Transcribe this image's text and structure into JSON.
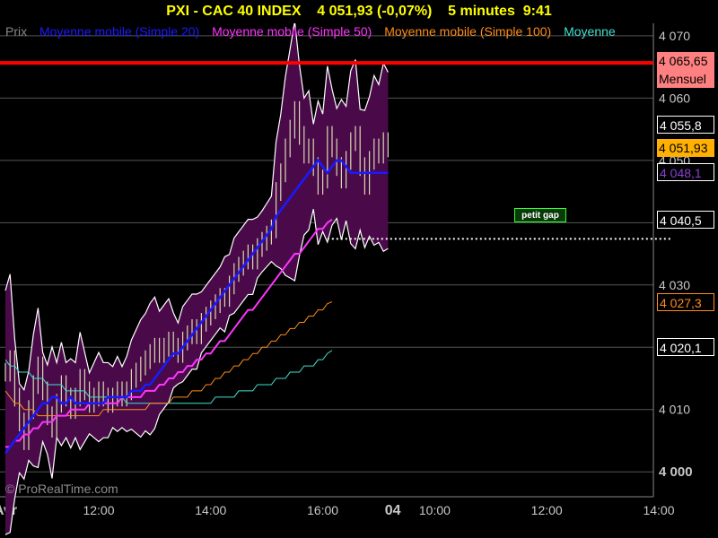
{
  "title": "PXI - CAC 40 INDEX    4 051,93 (-0,07%)    5 minutes  9:41",
  "legend": [
    {
      "label": "Prix",
      "color": "#888888"
    },
    {
      "label": "Moyenne mobile (Simple 20)",
      "color": "#1a1aff"
    },
    {
      "label": "Moyenne mobile (Simple 50)",
      "color": "#ff33ff"
    },
    {
      "label": "Moyenne mobile (Simple 100)",
      "color": "#ff8c1a"
    },
    {
      "label": "Moyenne",
      "color": "#40e0d0"
    }
  ],
  "watermark": "© ProRealTime.com",
  "annotation": "petit gap",
  "price_tags": [
    {
      "value": "4 065,65",
      "sub": "Mensuel",
      "bg": "#ff8080",
      "fg": "#000000",
      "y": 4065.65
    },
    {
      "value": "4 055,8",
      "bg": "#000000",
      "fg": "#ffffff",
      "border": "#ffffff",
      "y": 4055.8
    },
    {
      "value": "4 051,93",
      "bg": "#ffb000",
      "fg": "#000000",
      "y": 4051.93
    },
    {
      "value": "4 048,1",
      "bg": "#000000",
      "fg": "#8b3fd9",
      "border": "#ffffff",
      "y": 4048.1
    },
    {
      "value": "4 040,5",
      "bg": "#000000",
      "fg": "#ffffff",
      "border": "#ffffff",
      "y": 4040.5
    },
    {
      "value": "4 027,3",
      "bg": "#000000",
      "fg": "#ff8c1a",
      "border": "#ff8c1a",
      "y": 4027.3
    },
    {
      "value": "4 020,1",
      "bg": "#000000",
      "fg": "#ffffff",
      "border": "#ffffff",
      "y": 4020.1
    }
  ],
  "chart_data": {
    "type": "line",
    "ylim": [
      3996,
      4072
    ],
    "yticks": [
      {
        "value": 4000,
        "label": "4 000"
      },
      {
        "value": 4010,
        "label": "4 010"
      },
      {
        "value": 4020,
        "label": "4 020"
      },
      {
        "value": 4030,
        "label": "4 030"
      },
      {
        "value": 4040,
        "label": "4 040"
      },
      {
        "value": 4050,
        "label": "4 050"
      },
      {
        "value": 4060,
        "label": "4 060"
      },
      {
        "value": 4070,
        "label": "4 070"
      }
    ],
    "xticks": [
      {
        "index": 0,
        "label": "Avr"
      },
      {
        "index": 20,
        "label": "12:00"
      },
      {
        "index": 44,
        "label": "14:00"
      },
      {
        "index": 68,
        "label": "16:00"
      },
      {
        "index": 83,
        "label": "04"
      },
      {
        "index": 92,
        "label": "10:00"
      },
      {
        "index": 116,
        "label": "12:00"
      },
      {
        "index": 140,
        "label": "14:00"
      }
    ],
    "x_count": 145,
    "resistance_line": 4065.65,
    "gap_line": {
      "y": 4037.4,
      "from_index": 69,
      "to_index": 143
    },
    "price": [
      4016,
      4018,
      4012,
      4008,
      4005,
      4010,
      4014,
      4017,
      4013,
      4009,
      4007,
      4011,
      4014,
      4012,
      4010,
      4012,
      4015,
      4013,
      4011,
      4012,
      4013,
      4012,
      4011,
      4012,
      4013,
      4012,
      4013,
      4015,
      4016,
      4017,
      4018,
      4019,
      4020,
      4019,
      4020,
      4021,
      4020,
      4019,
      4021,
      4022,
      4023,
      4022,
      4024,
      4025,
      4026,
      4027,
      4028,
      4028,
      4030,
      4032,
      4033,
      4034,
      4035,
      4034,
      4036,
      4037,
      4038,
      4039,
      4045,
      4048,
      4052,
      4055,
      4058,
      4054,
      4051,
      4052,
      4049,
      4046,
      4047,
      4054,
      4052,
      4049,
      4047,
      4050,
      4053,
      4054,
      4049,
      4046,
      4050,
      4052,
      4051,
      4053,
      4052
    ],
    "sma20": [
      4003,
      4004,
      4005,
      4006,
      4007,
      4008,
      4009,
      4010,
      4011,
      4011,
      4012,
      4012,
      4011,
      4011,
      4012,
      4011,
      4011,
      4011,
      4011,
      4011,
      4011,
      4011,
      4012,
      4012,
      4012,
      4012,
      4012,
      4013,
      4013,
      4013,
      4014,
      4014,
      4015,
      4016,
      4017,
      4018,
      4019,
      4019,
      4020,
      4021,
      4022,
      4023,
      4024,
      4025,
      4026,
      4027,
      4028,
      4029,
      4030,
      4031,
      4032,
      4033,
      4034,
      4035,
      4036,
      4037,
      4038,
      4039,
      4041,
      4042,
      4043,
      4044,
      4045,
      4046,
      4047,
      4048,
      4049,
      4050,
      4049,
      4048,
      4049,
      4050,
      4050,
      4049,
      4048,
      4048,
      4048,
      4048,
      4048,
      4048,
      4048,
      4048,
      4048
    ],
    "sma50": [
      4004,
      4004,
      4005,
      4005,
      4006,
      4006,
      4007,
      4007,
      4008,
      4008,
      4008,
      4009,
      4009,
      4009,
      4010,
      4010,
      4010,
      4010,
      4011,
      4011,
      4011,
      4011,
      4011,
      4011,
      4011,
      4012,
      4012,
      4012,
      4012,
      4012,
      4013,
      4013,
      4013,
      4014,
      4014,
      4015,
      4015,
      4016,
      4016,
      4017,
      4017,
      4018,
      4018,
      4019,
      4019,
      4020,
      4021,
      4021,
      4022,
      4023,
      4024,
      4025,
      4026,
      4026,
      4027,
      4028,
      4029,
      4030,
      4031,
      4032,
      4033,
      4034,
      4035,
      4035,
      4036,
      4037,
      4038,
      4039,
      4039,
      4040,
      4040.5
    ],
    "sma100": [
      4013,
      4012,
      4011,
      4011,
      4010,
      4010,
      4010,
      4009,
      4009,
      4009,
      4009,
      4009,
      4009,
      4009,
      4009,
      4009,
      4009,
      4009,
      4009,
      4009,
      4009,
      4010,
      4010,
      4010,
      4010,
      4010,
      4010,
      4010,
      4010,
      4010,
      4010,
      4011,
      4011,
      4011,
      4011,
      4011,
      4012,
      4012,
      4012,
      4012,
      4013,
      4013,
      4013,
      4014,
      4014,
      4015,
      4015,
      4016,
      4016,
      4017,
      4017,
      4018,
      4018,
      4019,
      4019,
      4020,
      4020,
      4021,
      4021,
      4022,
      4022,
      4023,
      4023,
      4024,
      4024,
      4025,
      4025,
      4026,
      4026,
      4027,
      4027.3
    ],
    "sma_cyan": [
      4018,
      4017,
      4017,
      4016,
      4016,
      4016,
      4015,
      4015,
      4015,
      4014,
      4014,
      4014,
      4014,
      4013,
      4013,
      4013,
      4013,
      4013,
      4012,
      4012,
      4012,
      4012,
      4012,
      4012,
      4012,
      4012,
      4011,
      4011,
      4011,
      4011,
      4011,
      4011,
      4011,
      4011,
      4011,
      4011,
      4011,
      4011,
      4011,
      4011,
      4011,
      4011,
      4011,
      4011,
      4011,
      4012,
      4012,
      4012,
      4012,
      4012,
      4013,
      4013,
      4013,
      4013,
      4014,
      4014,
      4014,
      4014,
      4015,
      4015,
      4015,
      4016,
      4016,
      4016,
      4017,
      4017,
      4017,
      4018,
      4018,
      4019,
      4019.5
    ]
  },
  "colors": {
    "background": "#000000",
    "band_fill": "#4a0a4a",
    "band_edge": "#ffffff",
    "grid": "#555555",
    "resistance": "#ff0000",
    "title": "#ffff00",
    "axis_text": "#c8c8c8"
  }
}
